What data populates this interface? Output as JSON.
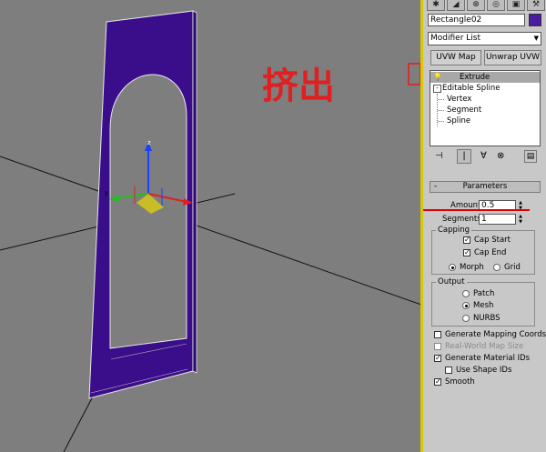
{
  "annotation": {
    "text": "挤出",
    "color": "#e02020"
  },
  "viewport": {
    "gizmo": {
      "z_label": "z",
      "y_label": "y"
    },
    "colors": {
      "object": "#3a0d8a",
      "background": "#7e7e7e",
      "active_border": "#d9c800"
    }
  },
  "panel": {
    "tabs": [
      "create-icon",
      "modify-icon",
      "hierarchy-icon",
      "motion-icon",
      "display-icon",
      "utilities-icon"
    ],
    "object_name": "Rectangle02",
    "object_color": "#4a1aa0",
    "modifier_list_label": "Modifier List",
    "buttons": {
      "uvw_map": "UVW Map",
      "unwrap_uvw": "Unwrap UVW"
    },
    "stack": {
      "items": [
        {
          "label": "Extrude",
          "selected": true
        },
        {
          "label": "Editable Spline",
          "selected": false
        },
        {
          "label": "Vertex",
          "selected": false
        },
        {
          "label": "Segment",
          "selected": false
        },
        {
          "label": "Spline",
          "selected": false
        }
      ]
    },
    "rollout": {
      "title": "Parameters",
      "collapse_symbol": "-",
      "amount_label": "Amount:",
      "amount_value": "0.5",
      "segments_label": "Segments:",
      "segments_value": "1",
      "capping": {
        "title": "Capping",
        "cap_start": "Cap Start",
        "cap_end": "Cap End",
        "morph": "Morph",
        "grid": "Grid"
      },
      "output": {
        "title": "Output",
        "patch": "Patch",
        "mesh": "Mesh",
        "nurbs": "NURBS"
      },
      "options": {
        "gen_mapping": "Generate Mapping Coords.",
        "real_world": "Real-World Map Size",
        "gen_material_ids": "Generate Material IDs",
        "use_shape_ids": "Use Shape IDs",
        "smooth": "Smooth"
      }
    }
  }
}
